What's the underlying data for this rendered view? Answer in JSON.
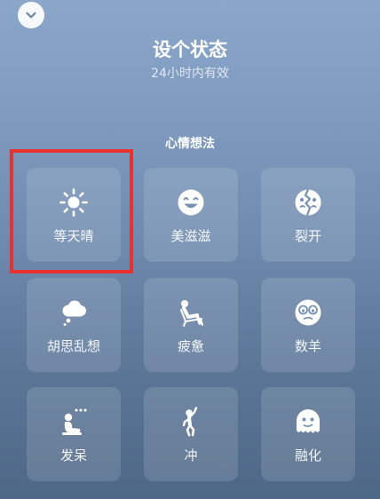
{
  "header": {
    "title": "设个状态",
    "subtitle": "24小时内有效"
  },
  "section": {
    "title": "心情想法"
  },
  "tiles": [
    {
      "label": "等天晴",
      "icon": "sun-icon"
    },
    {
      "label": "美滋滋",
      "icon": "smiley-face-icon"
    },
    {
      "label": "裂开",
      "icon": "cracked-face-icon"
    },
    {
      "label": "胡思乱想",
      "icon": "thought-cloud-icon"
    },
    {
      "label": "疲惫",
      "icon": "reclining-person-icon"
    },
    {
      "label": "数羊",
      "icon": "sleepy-eyes-face-icon"
    },
    {
      "label": "发呆",
      "icon": "sitting-person-dots-icon"
    },
    {
      "label": "冲",
      "icon": "cheering-person-icon"
    },
    {
      "label": "融化",
      "icon": "melting-face-icon"
    }
  ],
  "colors": {
    "background_top": "#8aa6c9",
    "background_bottom": "#4e6787",
    "highlight_border": "#e8322e",
    "icon": "#ffffff"
  }
}
